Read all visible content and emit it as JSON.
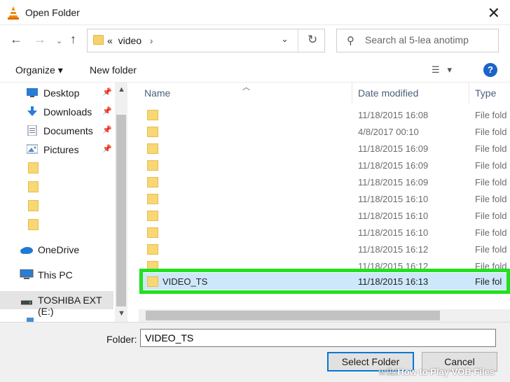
{
  "window": {
    "title": "Open Folder"
  },
  "address": {
    "crumb_prefix": "«",
    "folder": "video",
    "crumb_arrow": "›"
  },
  "search": {
    "placeholder": "Search al 5-lea anotimp"
  },
  "toolbar": {
    "organize": "Organize ▾",
    "new_folder": "New folder",
    "help": "?"
  },
  "nav": {
    "desktop": "Desktop",
    "downloads": "Downloads",
    "documents": "Documents",
    "pictures": "Pictures",
    "onedrive": "OneDrive",
    "thispc": "This PC",
    "drive": "TOSHIBA EXT (E:)"
  },
  "columns": {
    "name": "Name",
    "date": "Date modified",
    "type": "Type"
  },
  "rows": [
    {
      "name": "",
      "date": "11/18/2015 16:08",
      "type": "File fold"
    },
    {
      "name": "",
      "date": "4/8/2017 00:10",
      "type": "File fold"
    },
    {
      "name": "",
      "date": "11/18/2015 16:09",
      "type": "File fold"
    },
    {
      "name": "",
      "date": "11/18/2015 16:09",
      "type": "File fold"
    },
    {
      "name": "",
      "date": "11/18/2015 16:09",
      "type": "File fold"
    },
    {
      "name": "",
      "date": "11/18/2015 16:10",
      "type": "File fold"
    },
    {
      "name": "",
      "date": "11/18/2015 16:10",
      "type": "File fold"
    },
    {
      "name": "",
      "date": "11/18/2015 16:10",
      "type": "File fold"
    },
    {
      "name": "",
      "date": "11/18/2015 16:12",
      "type": "File fold"
    },
    {
      "name": "",
      "date": "11/18/2015 16:12",
      "type": "File fold"
    },
    {
      "name": "VIDEO_TS",
      "date": "11/18/2015 16:13",
      "type": "File fol"
    }
  ],
  "footer": {
    "folder_label": "Folder:",
    "folder_value": "VIDEO_TS",
    "select_button": "Select Folder",
    "cancel_button": "Cancel"
  },
  "watermark": {
    "wiki": "wiki",
    "text": "How to Play VOB Files"
  },
  "colors": {
    "selection": "#cde8fb",
    "highlight": "#21e021",
    "folder": "#f8d775",
    "accent": "#0078d7"
  }
}
